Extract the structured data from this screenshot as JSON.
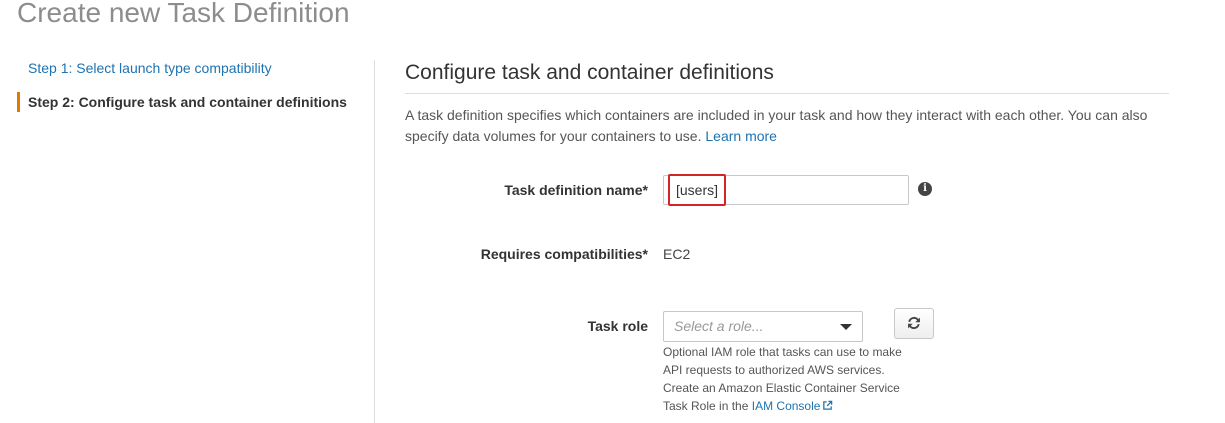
{
  "page": {
    "title": "Create new Task Definition"
  },
  "steps": [
    {
      "label": "Step 1: Select launch type compatibility",
      "active": false
    },
    {
      "label": "Step 2: Configure task and container definitions",
      "active": true
    }
  ],
  "section": {
    "title": "Configure task and container definitions",
    "description": "A task definition specifies which containers are included in your task and how they interact with each other. You can also specify data volumes for your containers to use.",
    "learn_more": "Learn more"
  },
  "fields": {
    "task_definition_name": {
      "label": "Task definition name*",
      "value": "[users]",
      "info_icon": "info-icon"
    },
    "requires_compatibilities": {
      "label": "Requires compatibilities*",
      "value": "EC2"
    },
    "task_role": {
      "label": "Task role",
      "placeholder": "Select a role...",
      "help_text": "Optional IAM role that tasks can use to make API requests to authorized AWS services. Create an Amazon Elastic Container Service Task Role in the",
      "help_link": "IAM Console",
      "refresh_icon": "refresh-icon"
    }
  },
  "colors": {
    "link": "#1e73b0",
    "active_step_border": "#e07b00",
    "highlight_border": "#d3242a",
    "title_gray": "#8d8d8d"
  }
}
